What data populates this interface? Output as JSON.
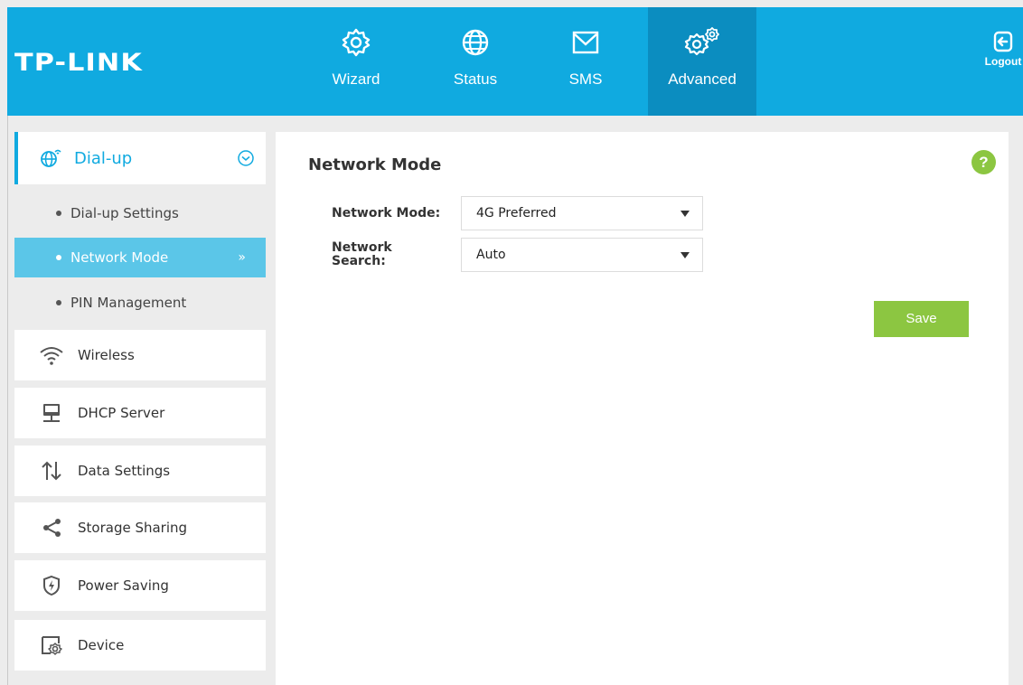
{
  "brand": {
    "logo": "TP-LINK"
  },
  "colors": {
    "accent": "#10aae0",
    "accent_dark": "#0b8dc0",
    "submenu_active": "#5bc6e8",
    "button": "#8cc641"
  },
  "top_nav": {
    "tabs": [
      {
        "label": "Wizard",
        "icon": "gear-icon",
        "active": false
      },
      {
        "label": "Status",
        "icon": "globe-icon",
        "active": false
      },
      {
        "label": "SMS",
        "icon": "envelope-icon",
        "active": false
      },
      {
        "label": "Advanced",
        "icon": "gears-icon",
        "active": true
      }
    ],
    "logout_label": "Logout"
  },
  "sidebar": {
    "dialup": {
      "label": "Dial-up",
      "icon": "globe-signal-icon",
      "expanded": true,
      "children": [
        {
          "label": "Dial-up Settings",
          "active": false
        },
        {
          "label": "Network Mode",
          "active": true
        },
        {
          "label": "PIN Management",
          "active": false
        }
      ]
    },
    "items": [
      {
        "label": "Wireless",
        "icon": "wifi-icon"
      },
      {
        "label": "DHCP Server",
        "icon": "network-computer-icon"
      },
      {
        "label": "Data Settings",
        "icon": "up-down-arrows-icon"
      },
      {
        "label": "Storage Sharing",
        "icon": "share-icon"
      },
      {
        "label": "Power Saving",
        "icon": "power-shield-icon"
      },
      {
        "label": "Device",
        "icon": "device-settings-icon"
      }
    ]
  },
  "main": {
    "title": "Network Mode",
    "help_icon": "?",
    "fields": {
      "network_mode": {
        "label": "Network Mode:",
        "value": "4G Preferred"
      },
      "network_search": {
        "label_line1": "Network",
        "label_line2": "Search:",
        "value": "Auto"
      }
    },
    "save_label": "Save"
  }
}
